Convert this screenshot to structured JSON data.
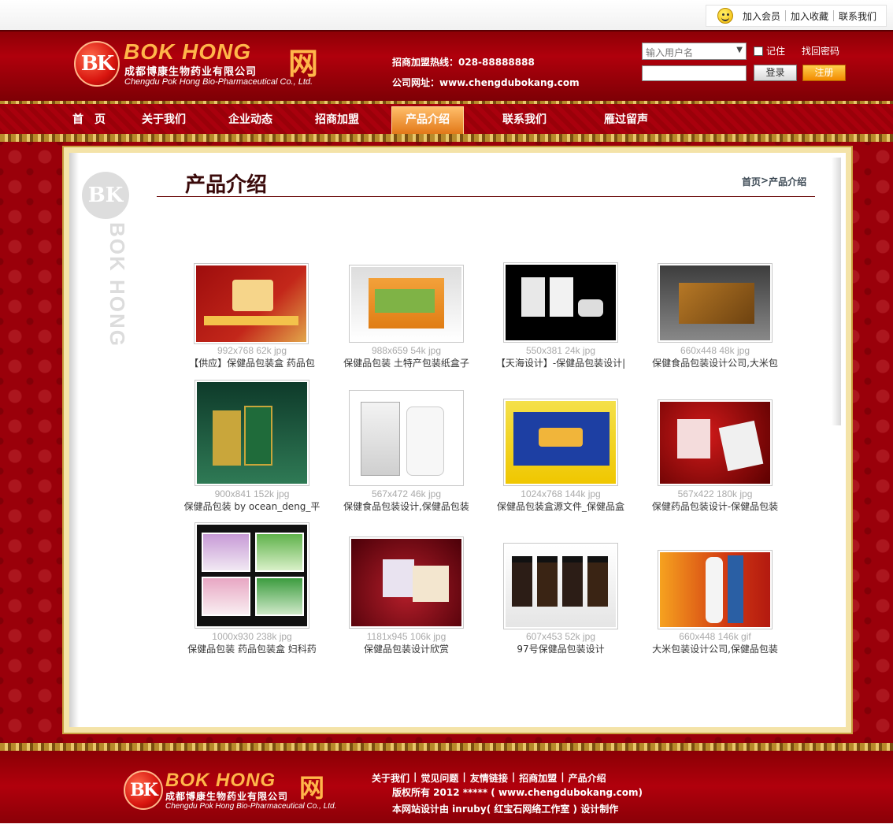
{
  "topbar": {
    "links": [
      "加入会员",
      "加入收藏",
      "联系我们"
    ]
  },
  "header": {
    "logo_mark": "BK",
    "logo_en": "BOK HONG",
    "logo_wang": "网",
    "logo_cn": "成都博康生物药业有限公司",
    "logo_sub": "Chengdu Pok Hong Bio-Pharmaceutical Co., Ltd.",
    "hotline": "招商加盟热线：028-88888888",
    "website": "公司网址：www.chengdubokang.com",
    "username_placeholder": "输入用户名",
    "remember_label": "记住",
    "forgot_label": "找回密码",
    "login_label": "登录",
    "register_label": "注册"
  },
  "nav": {
    "items": [
      "首　页",
      "关于我们",
      "企业动态",
      "招商加盟",
      "产品介绍",
      "联系我们",
      "雁过留声"
    ],
    "active_index": 4
  },
  "page": {
    "title": "产品介绍",
    "breadcrumb": [
      "首页",
      ">",
      "产品介绍"
    ]
  },
  "products": [
    {
      "meta": "992x768 62k jpg",
      "name": "【供应】保健品包装盒 药品包"
    },
    {
      "meta": "988x659 54k jpg",
      "name": "保健品包装 土特产包装纸盒子"
    },
    {
      "meta": "550x381 24k jpg",
      "name": "【天海设计】-保健品包装设计|"
    },
    {
      "meta": "660x448 48k jpg",
      "name": "保健食品包装设计公司,大米包"
    },
    {
      "meta": "900x841 152k jpg",
      "name": "保健品包装 by ocean_deng_平"
    },
    {
      "meta": "567x472 46k jpg",
      "name": "保健食品包装设计,保健品包装"
    },
    {
      "meta": "1024x768 144k jpg",
      "name": "保健品包装盒源文件_保健品盒"
    },
    {
      "meta": "567x422 180k jpg",
      "name": "保健药品包装设计-保健品包装"
    },
    {
      "meta": "1000x930 238k jpg",
      "name": "保健品包装 药品包装盒 妇科药"
    },
    {
      "meta": "1181x945 106k jpg",
      "name": "保健品包装设计欣赏"
    },
    {
      "meta": "607x453 52k jpg",
      "name": "97号保健品包装设计"
    },
    {
      "meta": "660x448 146k gif",
      "name": "大米包装设计公司,保健品包装"
    }
  ],
  "footer": {
    "links": [
      "关于我们",
      "觉见问题",
      "友情链接",
      "招商加盟",
      "产品介绍"
    ],
    "copyright": "版权所有 2012 ***** ( www.chengdubokang.com)",
    "designer": "本网站设计由 inruby( 红宝石网络工作室 ) 设计制作"
  }
}
